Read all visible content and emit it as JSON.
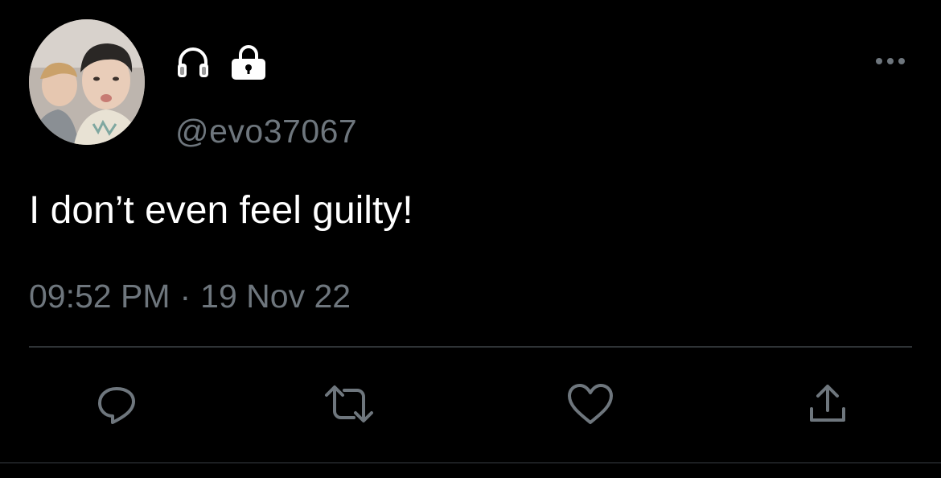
{
  "tweet": {
    "handle": "@evo37067",
    "text": "I don’t even feel guilty!",
    "time": "09:52 PM",
    "separator": "·",
    "date": "19 Nov 22"
  },
  "name_icons": [
    "headphones-icon",
    "lock-icon"
  ],
  "actions": [
    "reply-icon",
    "retweet-icon",
    "like-icon",
    "share-icon"
  ],
  "colors": {
    "background": "#000000",
    "text": "#ffffff",
    "secondary": "#6e767d",
    "divider": "#2f3336"
  }
}
